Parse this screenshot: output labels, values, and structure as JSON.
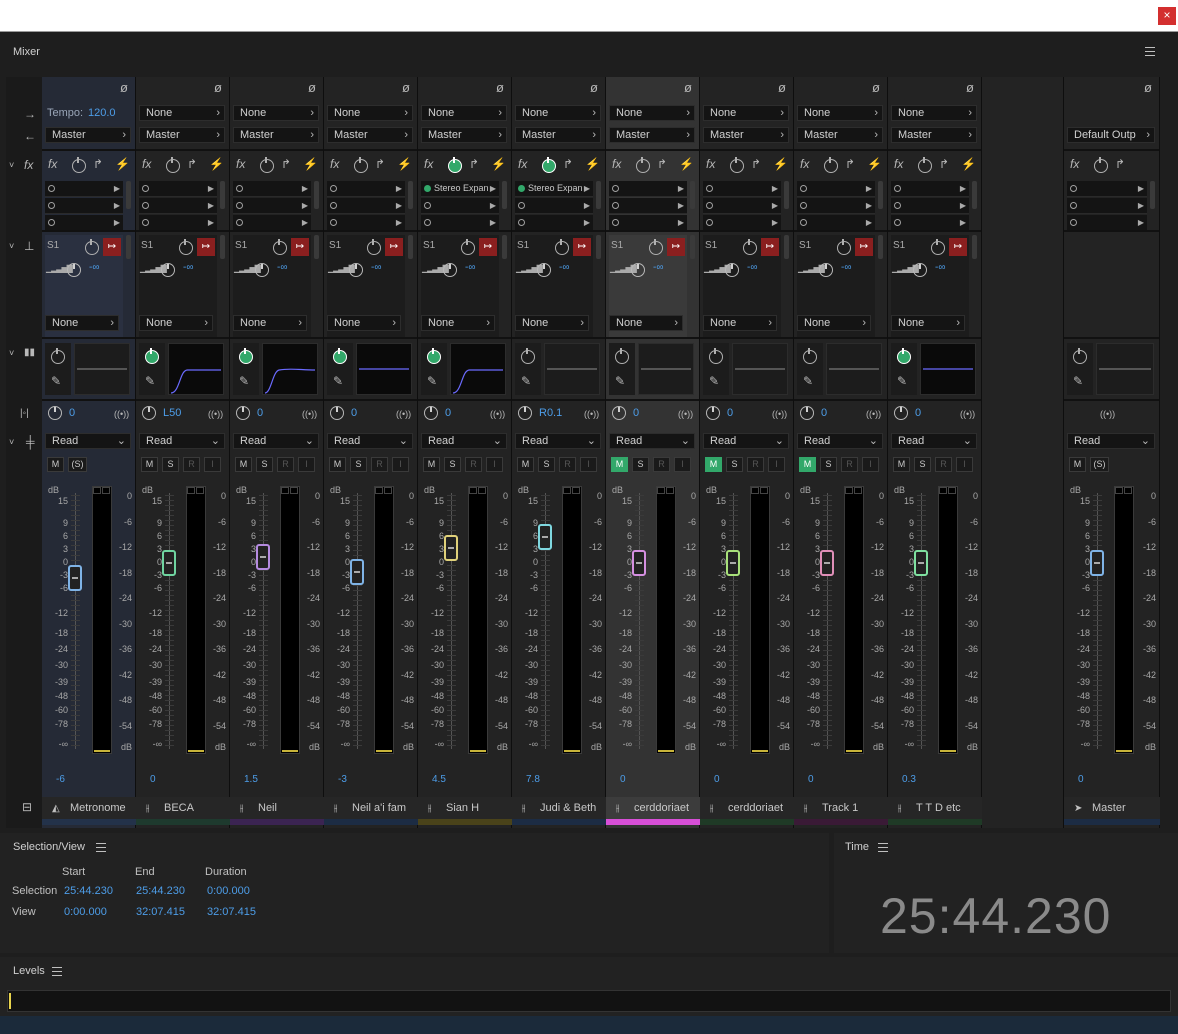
{
  "window": {
    "close_label": "×"
  },
  "mixer_panel": {
    "title": "Mixer"
  },
  "metronome": {
    "tempo_label": "Tempo:",
    "tempo_value": "120.0",
    "output": "Master"
  },
  "common": {
    "send_label": "S1",
    "send_level": "-∞",
    "automation_mode": "Read",
    "none": "None",
    "master": "Master",
    "mute": "M",
    "solo": "S",
    "solo_safe": "(S)",
    "record": "R",
    "input": "I",
    "scale_db": "dB",
    "left_scale": [
      "15",
      "9",
      "6",
      "3",
      "0",
      "-3",
      "-6",
      "-12",
      "-18",
      "-24",
      "-30",
      "-39",
      "-48",
      "-60",
      "-78",
      "-∞"
    ],
    "right_scale": [
      "0",
      "-6",
      "-12",
      "-18",
      "-24",
      "-30",
      "-36",
      "-42",
      "-48",
      "-54",
      "dB"
    ]
  },
  "tracks": [
    {
      "name": "Metronome",
      "input": "",
      "output": "Master",
      "fx": [
        "",
        "",
        ""
      ],
      "pan": "0",
      "volume": "-6",
      "fader_db": -3.5,
      "send_dest": "None",
      "color": "#23324a",
      "mute_on": false,
      "has_rec": false,
      "eq_on": false,
      "selected": false
    },
    {
      "name": "BECA",
      "input": "None",
      "output": "Master",
      "fx": [
        "",
        "",
        ""
      ],
      "pan": "L50",
      "volume": "0",
      "fader_db": 0,
      "send_dest": "None",
      "color": "#1e3a2e",
      "mute_on": false,
      "has_rec": true,
      "eq_on": true,
      "selected": false
    },
    {
      "name": "Neil",
      "input": "None",
      "output": "Master",
      "fx": [
        "",
        "",
        ""
      ],
      "pan": "0",
      "volume": "1.5",
      "fader_db": 1.5,
      "send_dest": "None",
      "color": "#3b2452",
      "mute_on": false,
      "has_rec": true,
      "eq_on": true,
      "selected": false
    },
    {
      "name": "Neil a'i fam",
      "input": "None",
      "output": "Master",
      "fx": [
        "",
        "",
        ""
      ],
      "pan": "0",
      "volume": "-3",
      "fader_db": -2,
      "send_dest": "None",
      "color": "#1c2c44",
      "mute_on": false,
      "has_rec": true,
      "eq_on": true,
      "selected": false
    },
    {
      "name": "Sian H",
      "input": "None",
      "output": "Master",
      "fx": [
        "Stereo Expan",
        "",
        ""
      ],
      "pan": "0",
      "volume": "4.5",
      "fader_db": 3.5,
      "send_dest": "None",
      "color": "#4a431a",
      "mute_on": false,
      "has_rec": true,
      "eq_on": true,
      "selected": false
    },
    {
      "name": "Judi & Beth",
      "input": "None",
      "output": "Master",
      "fx": [
        "Stereo Expan",
        "",
        ""
      ],
      "pan": "R0.1",
      "volume": "7.8",
      "fader_db": 6,
      "send_dest": "None",
      "color": "#1c2c44",
      "mute_on": false,
      "has_rec": true,
      "eq_on": false,
      "selected": false
    },
    {
      "name": "cerddoriaet",
      "input": "None",
      "output": "Master",
      "fx": [
        "",
        "",
        ""
      ],
      "pan": "0",
      "volume": "0",
      "fader_db": 0,
      "send_dest": "None",
      "color": "#d84fd8",
      "mute_on": true,
      "has_rec": true,
      "eq_on": false,
      "selected": true
    },
    {
      "name": "cerddoriaet",
      "input": "None",
      "output": "Master",
      "fx": [
        "",
        "",
        ""
      ],
      "pan": "0",
      "volume": "0",
      "fader_db": 0,
      "send_dest": "None",
      "color": "#1f3a26",
      "mute_on": true,
      "has_rec": true,
      "eq_on": false,
      "selected": false
    },
    {
      "name": "Track 1",
      "input": "None",
      "output": "Master",
      "fx": [
        "",
        "",
        ""
      ],
      "pan": "0",
      "volume": "0",
      "fader_db": 0,
      "send_dest": "None",
      "color": "#3a1a36",
      "mute_on": true,
      "has_rec": true,
      "eq_on": false,
      "selected": false
    },
    {
      "name": "T T D etc",
      "input": "None",
      "output": "Master",
      "fx": [
        "",
        "",
        ""
      ],
      "pan": "0",
      "volume": "0.3",
      "fader_db": 0,
      "send_dest": "None",
      "color": "#1f3a26",
      "mute_on": false,
      "has_rec": true,
      "eq_on": true,
      "selected": false
    }
  ],
  "master": {
    "name": "Master",
    "output": "Default Outp",
    "volume": "0",
    "fader_db": 0,
    "color": "#1c2c44"
  },
  "selection_view": {
    "title": "Selection/View",
    "col_start": "Start",
    "col_end": "End",
    "col_duration": "Duration",
    "selection_label": "Selection",
    "view_label": "View",
    "selection_start": "25:44.230",
    "selection_end": "25:44.230",
    "selection_duration": "0:00.000",
    "view_start": "0:00.000",
    "view_end": "32:07.415",
    "view_duration": "32:07.415"
  },
  "time_panel": {
    "title": "Time",
    "value": "25:44.230"
  },
  "levels_panel": {
    "title": "Levels"
  }
}
